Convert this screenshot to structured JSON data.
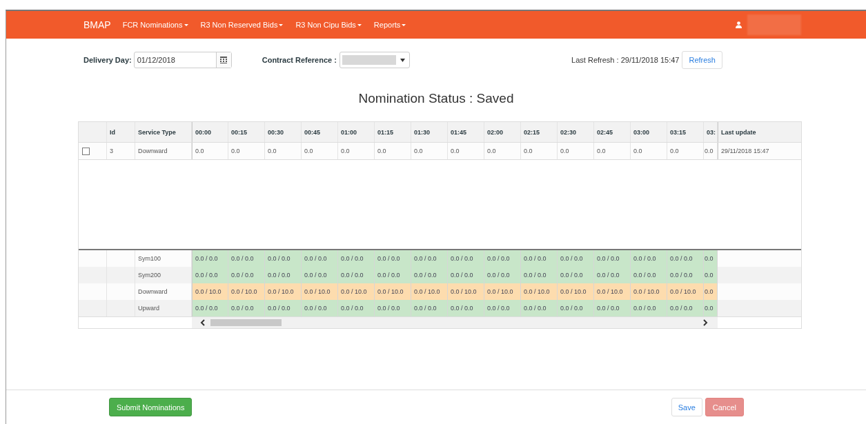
{
  "navbar": {
    "brand": "BMAP",
    "menus": [
      {
        "label": "FCR Nominations"
      },
      {
        "label": "R3 Non Reserved Bids"
      },
      {
        "label": "R3 Non Cipu Bids"
      },
      {
        "label": "Reports"
      }
    ]
  },
  "filters": {
    "delivery_day": {
      "label": "Delivery Day:",
      "value": "01/12/2018"
    },
    "contract_reference": {
      "label": "Contract Reference :"
    },
    "last_refresh": "Last Refresh : 29/11/2018 15:47",
    "refresh_button": "Refresh"
  },
  "status_title": "Nomination Status : Saved",
  "table": {
    "columns": [
      "Id",
      "Service Type",
      "00:00",
      "00:15",
      "00:30",
      "00:45",
      "01:00",
      "01:15",
      "01:30",
      "01:45",
      "02:00",
      "02:15",
      "02:30",
      "02:45",
      "03:00",
      "03:15",
      "03:",
      "Last update"
    ],
    "rows": [
      {
        "checked": false,
        "id": "3",
        "service_type": "Downward",
        "values": [
          "0.0",
          "0.0",
          "0.0",
          "0.0",
          "0.0",
          "0.0",
          "0.0",
          "0.0",
          "0.0",
          "0.0",
          "0.0",
          "0.0",
          "0.0",
          "0.0",
          "0.0"
        ],
        "last_update": "29/11/2018 15:47"
      }
    ]
  },
  "summary": [
    {
      "service_type": "Sym100",
      "color": "#c8e6c9",
      "values": [
        "0.0 / 0.0",
        "0.0 / 0.0",
        "0.0 / 0.0",
        "0.0 / 0.0",
        "0.0 / 0.0",
        "0.0 / 0.0",
        "0.0 / 0.0",
        "0.0 / 0.0",
        "0.0 / 0.0",
        "0.0 / 0.0",
        "0.0 / 0.0",
        "0.0 / 0.0",
        "0.0 / 0.0",
        "0.0 / 0.0",
        "0.0"
      ]
    },
    {
      "service_type": "Sym200",
      "color": "#c8e6c9",
      "values": [
        "0.0 / 0.0",
        "0.0 / 0.0",
        "0.0 / 0.0",
        "0.0 / 0.0",
        "0.0 / 0.0",
        "0.0 / 0.0",
        "0.0 / 0.0",
        "0.0 / 0.0",
        "0.0 / 0.0",
        "0.0 / 0.0",
        "0.0 / 0.0",
        "0.0 / 0.0",
        "0.0 / 0.0",
        "0.0 / 0.0",
        "0.0"
      ]
    },
    {
      "service_type": "Downward",
      "color": "#fddcae",
      "values": [
        "0.0 / 10.0",
        "0.0 / 10.0",
        "0.0 / 10.0",
        "0.0 / 10.0",
        "0.0 / 10.0",
        "0.0 / 10.0",
        "0.0 / 10.0",
        "0.0 / 10.0",
        "0.0 / 10.0",
        "0.0 / 10.0",
        "0.0 / 10.0",
        "0.0 / 10.0",
        "0.0 / 10.0",
        "0.0 / 10.0",
        "0.0"
      ]
    },
    {
      "service_type": "Upward",
      "color": "#c8e6c9",
      "values": [
        "0.0 / 0.0",
        "0.0 / 0.0",
        "0.0 / 0.0",
        "0.0 / 0.0",
        "0.0 / 0.0",
        "0.0 / 0.0",
        "0.0 / 0.0",
        "0.0 / 0.0",
        "0.0 / 0.0",
        "0.0 / 0.0",
        "0.0 / 0.0",
        "0.0 / 0.0",
        "0.0 / 0.0",
        "0.0 / 0.0",
        "0.0"
      ]
    }
  ],
  "buttons": {
    "submit": "Submit Nominations",
    "save": "Save",
    "cancel": {
      "label": "Cancel",
      "disabled": true
    }
  }
}
